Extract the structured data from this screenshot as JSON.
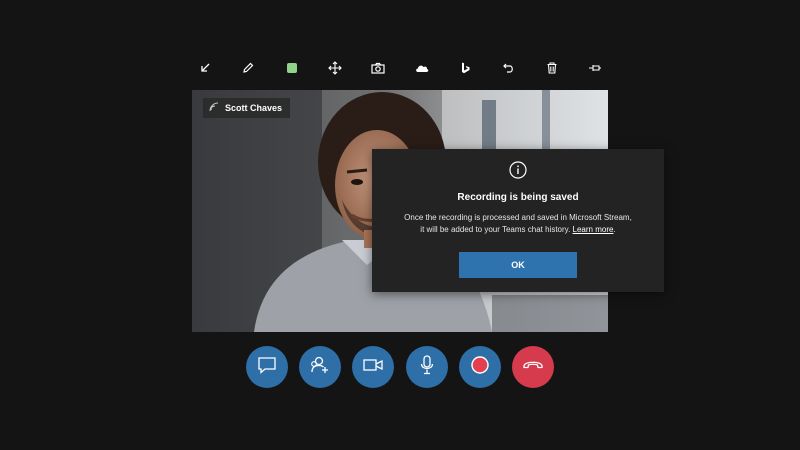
{
  "participant": {
    "name": "Scott Chaves",
    "signal_icon": "signal-strength-icon"
  },
  "toolbar": {
    "tools": [
      {
        "name": "minimize-arrow-icon"
      },
      {
        "name": "pen-icon"
      },
      {
        "name": "color-swatch-icon",
        "color": "#8fd48a"
      },
      {
        "name": "move-icon"
      },
      {
        "name": "camera-icon"
      },
      {
        "name": "cloud-icon"
      },
      {
        "name": "bing-icon"
      },
      {
        "name": "undo-icon"
      },
      {
        "name": "trash-icon"
      },
      {
        "name": "pin-icon"
      }
    ]
  },
  "dialog": {
    "icon": "info-icon",
    "title": "Recording is being saved",
    "body_line1": "Once the recording is processed and saved in Microsoft Stream,",
    "body_line2_prefix": "it will be added to your Teams chat history. ",
    "body_link": "Learn more",
    "body_line2_suffix": ".",
    "ok_label": "OK"
  },
  "controls": [
    {
      "name": "chat-button",
      "icon": "chat-icon"
    },
    {
      "name": "add-people-button",
      "icon": "add-person-icon"
    },
    {
      "name": "video-button",
      "icon": "video-camera-icon"
    },
    {
      "name": "mic-button",
      "icon": "microphone-icon"
    },
    {
      "name": "record-button",
      "icon": "record-icon"
    },
    {
      "name": "hang-up-button",
      "icon": "hang-up-icon"
    }
  ],
  "colors": {
    "background": "#141414",
    "control_blue": "#2e6fa7",
    "hangup_red": "#d53a4d",
    "record_red": "#e0404f",
    "ok_button": "#2f73ae",
    "dialog_bg": "#232323"
  }
}
